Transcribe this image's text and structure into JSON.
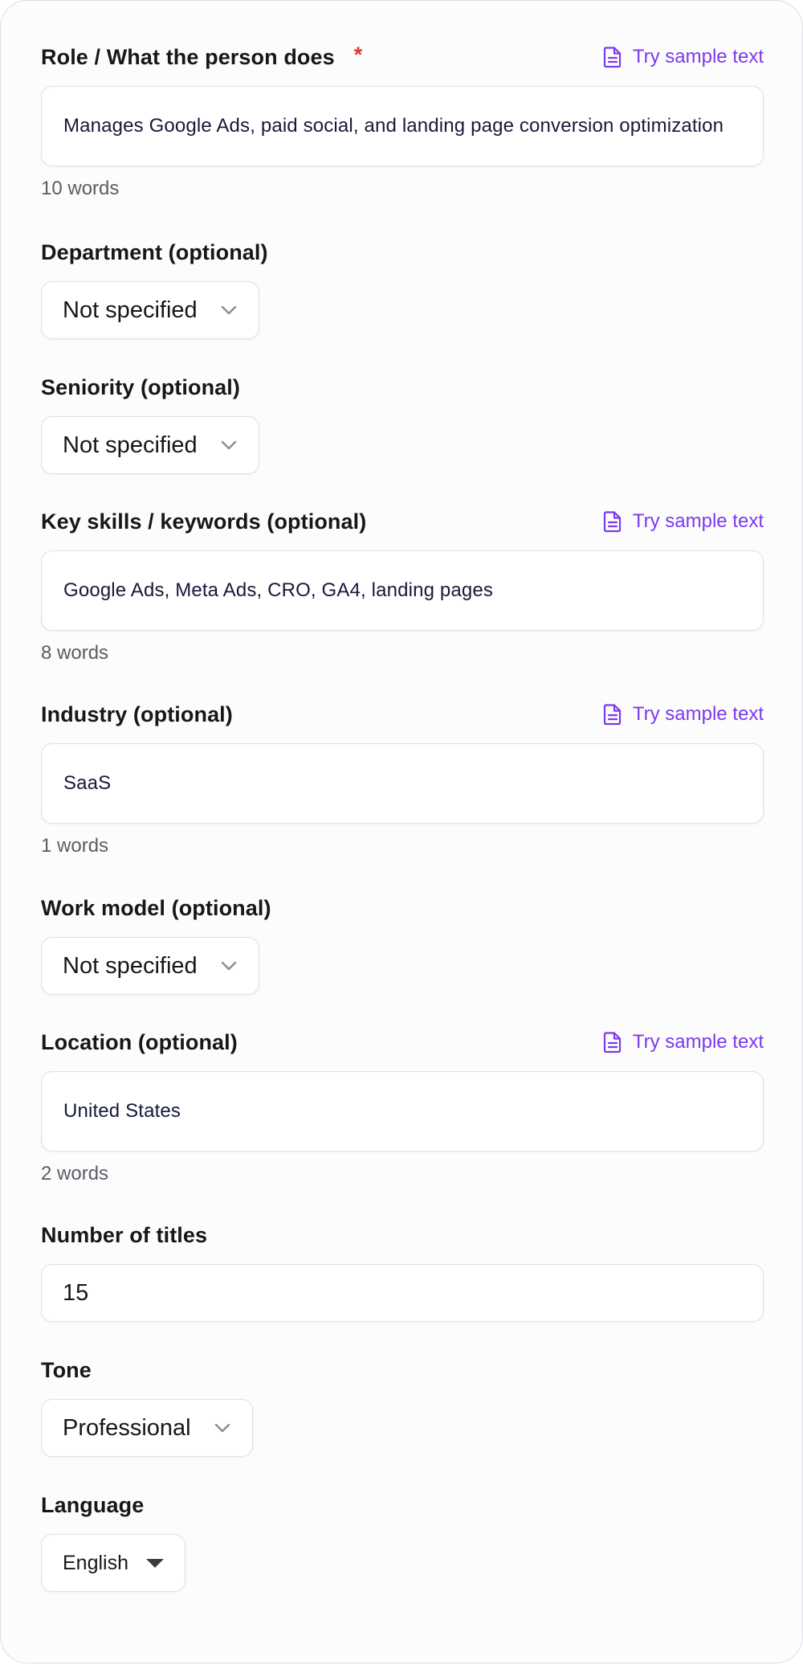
{
  "form": {
    "role": {
      "label": "Role / What the person does",
      "required_mark": "*",
      "sample_label": "Try sample text",
      "value": "Manages Google Ads, paid social, and landing page conversion optimization",
      "word_count": "10 words"
    },
    "department": {
      "label": "Department (optional)",
      "value": "Not specified"
    },
    "seniority": {
      "label": "Seniority (optional)",
      "value": "Not specified"
    },
    "skills": {
      "label": "Key skills / keywords (optional)",
      "sample_label": "Try sample text",
      "value": "Google Ads, Meta Ads, CRO, GA4, landing pages",
      "word_count": "8 words"
    },
    "industry": {
      "label": "Industry (optional)",
      "sample_label": "Try sample text",
      "value": "SaaS",
      "word_count": "1 words"
    },
    "work_model": {
      "label": "Work model (optional)",
      "value": "Not specified"
    },
    "location": {
      "label": "Location (optional)",
      "sample_label": "Try sample text",
      "value": "United States",
      "word_count": "2 words"
    },
    "num_titles": {
      "label": "Number of titles",
      "value": "15"
    },
    "tone": {
      "label": "Tone",
      "value": "Professional"
    },
    "language": {
      "label": "Language",
      "value": "English"
    }
  },
  "colors": {
    "accent": "#7c3aed",
    "required": "#e0332b",
    "input_text": "#161a3a",
    "muted_text": "#5b5d66",
    "border": "#dfe0e4"
  },
  "icons": {
    "sample": "document-icon",
    "select": "chevron-down-icon",
    "language": "caret-down-icon"
  }
}
